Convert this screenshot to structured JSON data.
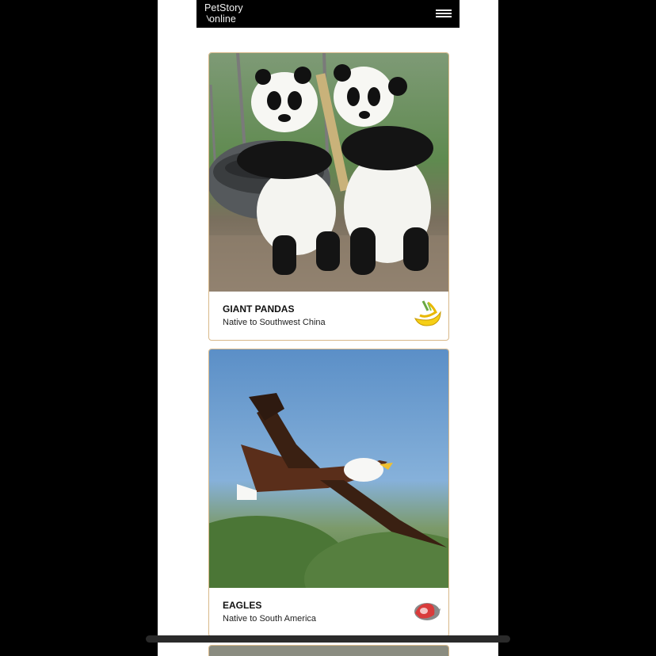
{
  "header": {
    "logo_line1": "PetStory",
    "logo_line2": "online",
    "menu_icon": "hamburger-menu-icon"
  },
  "cards": [
    {
      "title": "GIANT PANDAS",
      "subtitle": "Native to Southwest China",
      "food_icon": "banana-icon",
      "image": "two giant pandas playing on a tire swing"
    },
    {
      "title": "EAGLES",
      "subtitle": "Native to South America",
      "food_icon": "meat-icon",
      "image": "eagle flying over trees"
    }
  ],
  "colors": {
    "page_bg": "#000000",
    "content_bg": "#ffffff",
    "card_border": "#d9b98a",
    "header_bg": "#000000"
  }
}
